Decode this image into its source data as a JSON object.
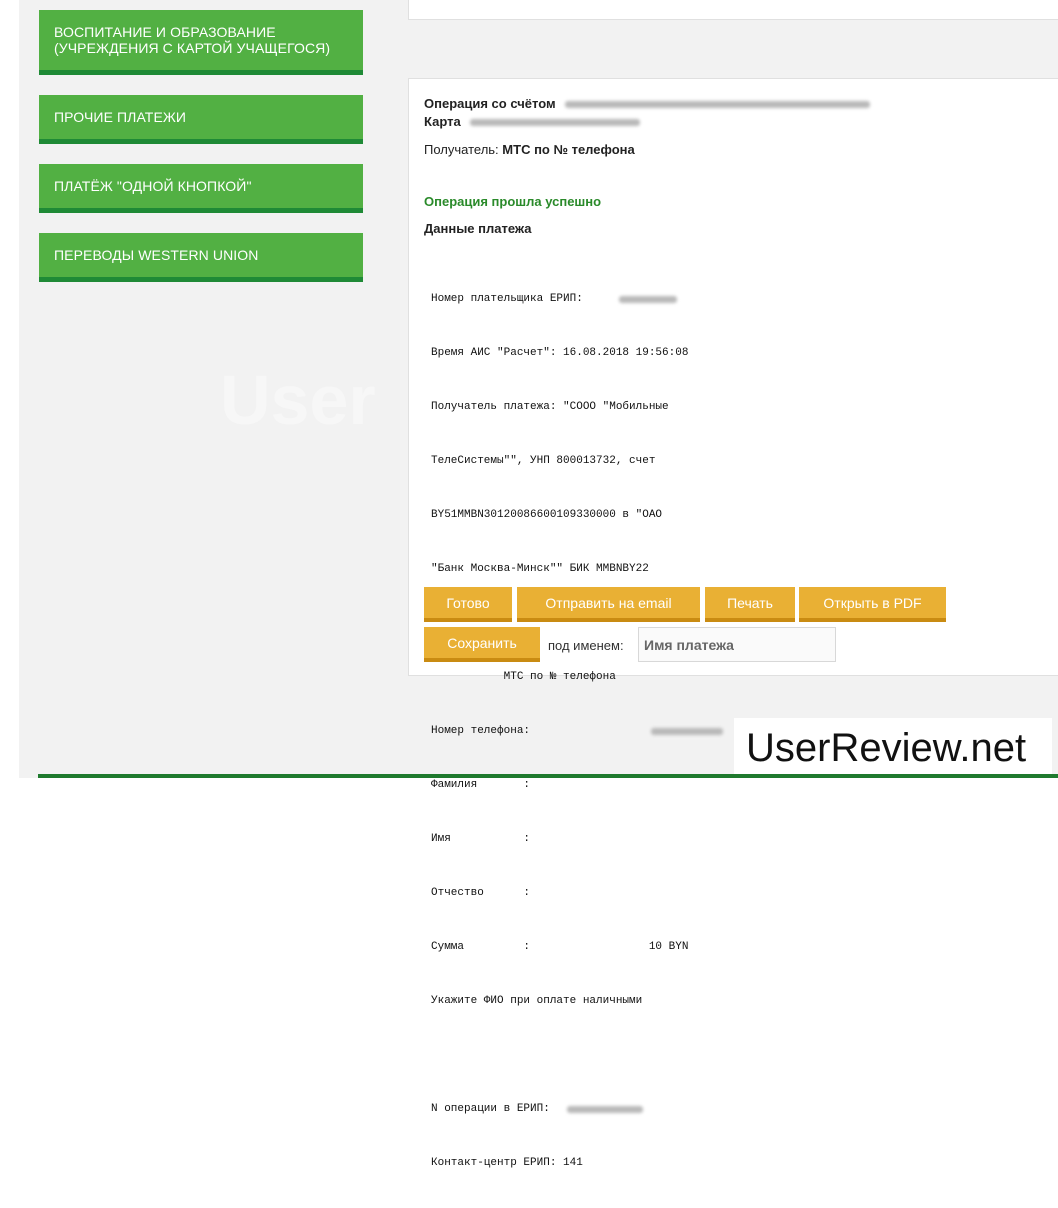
{
  "sidebar": {
    "items": [
      {
        "label_line1": "ВОСПИТАНИЕ И ОБРАЗОВАНИЕ",
        "label_line2": "(УЧРЕЖДЕНИЯ С КАРТОЙ УЧАЩЕГОСЯ)"
      },
      {
        "label": "ПРОЧИЕ ПЛАТЕЖИ"
      },
      {
        "label": "ПЛАТЁЖ \"ОДНОЙ КНОПКОЙ\""
      },
      {
        "label": "ПЕРЕВОДЫ WESTERN UNION"
      }
    ]
  },
  "operation": {
    "account_label": "Операция со счётом",
    "card_label": "Карта",
    "recipient_label": "Получатель:",
    "recipient_value": "МТС по № телефона",
    "status": "Операция прошла успешно",
    "payment_data_title": "Данные платежа"
  },
  "receipt": {
    "lines": [
      "Номер плательщика ЕРИП:",
      "Время АИС \"Расчет\": 16.08.2018 19:56:08",
      "Получатель платежа: \"СООО \"Мобильные",
      "ТелеСистемы\"\", УНП 800013732, счет",
      "BY51MMBN30120086600109330000 в \"ОАО",
      "\"Банк Москва-Минск\"\" БИК MMBNBY22",
      "",
      "           МТС по № телефона",
      "Номер телефона:",
      "Фамилия       :",
      "Имя           :",
      "Отчество      :",
      "Сумма         :                  10 BYN",
      "Укажите ФИО при оплате наличными",
      "",
      "N операции в ЕРИП:",
      "Контакт-центр ЕРИП: 141"
    ]
  },
  "actions": {
    "done": "Готово",
    "send_email": "Отправить на email",
    "print": "Печать",
    "open_pdf": "Открыть в PDF",
    "save": "Сохранить",
    "save_name_label": "под именем:",
    "save_name_placeholder": "Имя платежа"
  },
  "watermark": {
    "text": "UserReview.net"
  },
  "colors": {
    "menu_green": "#52b043",
    "menu_green_dark": "#1f8a36",
    "button_orange": "#e9b034",
    "success_green": "#2a8a2a"
  }
}
